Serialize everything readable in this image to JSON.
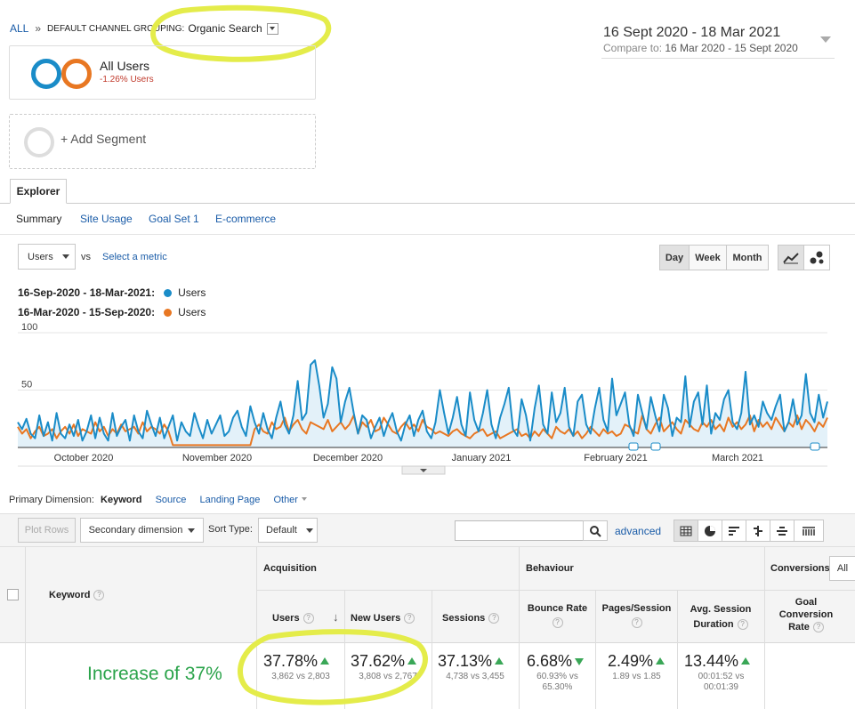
{
  "breadcrumb": {
    "all": "ALL",
    "sep": "»",
    "grouping": "DEFAULT CHANNEL GROUPING:",
    "value": "Organic Search"
  },
  "date_range": {
    "main": "16 Sept 2020 - 18 Mar 2021",
    "compare_label": "Compare to:",
    "compare": "16 Mar 2020 - 15 Sept 2020"
  },
  "segment": {
    "name": "All Users",
    "change": "-1.26% Users",
    "add": "+ Add Segment"
  },
  "tabs": {
    "explorer": "Explorer",
    "sub": [
      "Summary",
      "Site Usage",
      "Goal Set 1",
      "E-commerce"
    ]
  },
  "metric": {
    "selected": "Users",
    "vs": "vs",
    "select": "Select a metric"
  },
  "granularity": {
    "day": "Day",
    "week": "Week",
    "month": "Month"
  },
  "legend": [
    {
      "range": "16-Sep-2020 - 18-Mar-2021:",
      "label": "Users",
      "color": "#1a8cc8"
    },
    {
      "range": "16-Mar-2020 - 15-Sep-2020:",
      "label": "Users",
      "color": "#e87722"
    }
  ],
  "chart_data": {
    "type": "line",
    "y_ticks": [
      "100",
      "50"
    ],
    "ylim": [
      0,
      100
    ],
    "x_labels": [
      "October 2020",
      "November 2020",
      "December 2020",
      "January 2021",
      "February 2021",
      "March 2021"
    ],
    "series": [
      {
        "name": "Users",
        "color": "#1a8cc8",
        "values": [
          22,
          16,
          25,
          12,
          8,
          28,
          10,
          22,
          6,
          30,
          12,
          8,
          20,
          10,
          24,
          6,
          14,
          28,
          8,
          26,
          12,
          6,
          30,
          10,
          18,
          24,
          6,
          28,
          14,
          8,
          32,
          20,
          10,
          26,
          8,
          18,
          28,
          6,
          22,
          14,
          10,
          30,
          18,
          8,
          24,
          12,
          20,
          28,
          10,
          14,
          26,
          32,
          18,
          10,
          36,
          22,
          12,
          30,
          16,
          8,
          26,
          40,
          20,
          12,
          28,
          58,
          24,
          30,
          72,
          76,
          54,
          26,
          38,
          70,
          60,
          22,
          40,
          52,
          30,
          12,
          28,
          24,
          8,
          18,
          26,
          10,
          22,
          30,
          14,
          6,
          20,
          28,
          10,
          24,
          32,
          14,
          8,
          22,
          50,
          30,
          12,
          26,
          44,
          20,
          10,
          48,
          24,
          14,
          30,
          50,
          20,
          8,
          26,
          38,
          52,
          16,
          10,
          42,
          28,
          6,
          34,
          54,
          20,
          12,
          48,
          22,
          30,
          52,
          18,
          10,
          40,
          46,
          20,
          12,
          34,
          52,
          24,
          14,
          60,
          28,
          38,
          48,
          20,
          10,
          46,
          30,
          16,
          44,
          28,
          14,
          46,
          34,
          10,
          26,
          22,
          62,
          18,
          40,
          48,
          20,
          54,
          12,
          30,
          24,
          42,
          50,
          22,
          16,
          30,
          66,
          20,
          28,
          18,
          40,
          30,
          24,
          36,
          46,
          14,
          22,
          42,
          20,
          28,
          64,
          30,
          22,
          46,
          26,
          40
        ]
      },
      {
        "name": "Users",
        "color": "#e87722",
        "values": [
          18,
          12,
          16,
          8,
          14,
          18,
          10,
          12,
          16,
          8,
          14,
          18,
          12,
          20,
          10,
          16,
          14,
          12,
          22,
          14,
          18,
          10,
          16,
          12,
          20,
          14,
          16,
          18,
          12,
          22,
          14,
          18,
          16,
          12,
          20,
          14,
          2,
          2,
          2,
          2,
          2,
          2,
          2,
          2,
          2,
          2,
          2,
          2,
          2,
          2,
          2,
          2,
          2,
          2,
          2,
          16,
          20,
          14,
          12,
          22,
          16,
          18,
          26,
          14,
          20,
          24,
          16,
          12,
          22,
          20,
          18,
          16,
          24,
          14,
          18,
          22,
          16,
          20,
          28,
          12,
          22,
          18,
          24,
          14,
          16,
          26,
          20,
          14,
          12,
          18,
          22,
          16,
          20,
          14,
          24,
          18,
          16,
          12,
          14,
          12,
          10,
          14,
          16,
          12,
          10,
          8,
          12,
          14,
          16,
          10,
          12,
          14,
          8,
          10,
          12,
          14,
          16,
          10,
          12,
          8,
          14,
          10,
          16,
          12,
          8,
          18,
          14,
          12,
          16,
          10,
          14,
          8,
          12,
          18,
          14,
          10,
          16,
          12,
          14,
          10,
          12,
          20,
          18,
          14,
          12,
          28,
          16,
          12,
          20,
          26,
          14,
          18,
          22,
          16,
          12,
          24,
          20,
          16,
          14,
          22,
          18,
          24,
          16,
          20,
          14,
          26,
          18,
          22,
          16,
          20,
          28,
          14,
          24,
          18,
          22,
          16,
          26,
          20,
          14,
          22,
          18,
          28,
          16,
          24,
          20,
          14,
          22,
          18,
          26
        ]
      }
    ]
  },
  "dimension": {
    "label": "Primary Dimension:",
    "active": "Keyword",
    "options": [
      "Source",
      "Landing Page",
      "Other"
    ]
  },
  "controls": {
    "plot_rows": "Plot Rows",
    "secondary": "Secondary dimension",
    "sort_label": "Sort Type:",
    "sort_value": "Default",
    "advanced": "advanced"
  },
  "table": {
    "keyword_header": "Keyword",
    "groups": {
      "acquisition": "Acquisition",
      "behaviour": "Behaviour",
      "conversions": "Conversions",
      "conv_select": "All"
    },
    "columns": {
      "users": "Users",
      "new_users": "New Users",
      "sessions": "Sessions",
      "bounce": "Bounce Rate",
      "pages": "Pages/Session",
      "duration": "Avg. Session Duration",
      "goal": "Goal Conversion Rate"
    },
    "row": {
      "annotation": "Increase of 37%",
      "users": {
        "pct": "37.78%",
        "detail": "3,862 vs 2,803"
      },
      "new_users": {
        "pct": "37.62%",
        "detail": "3,808 vs 2,767"
      },
      "sessions": {
        "pct": "37.13%",
        "detail": "4,738 vs 3,455"
      },
      "bounce": {
        "pct": "6.68%",
        "detail1": "60.93% vs",
        "detail2": "65.30%"
      },
      "pages": {
        "pct": "2.49%",
        "detail": "1.89 vs 1.85"
      },
      "duration": {
        "pct": "13.44%",
        "detail1": "00:01:52 vs",
        "detail2": "00:01:39"
      }
    }
  },
  "colors": {
    "highlight": "#e4ec4a",
    "accent_blue": "#1a5ca8",
    "green": "#3aa757"
  }
}
